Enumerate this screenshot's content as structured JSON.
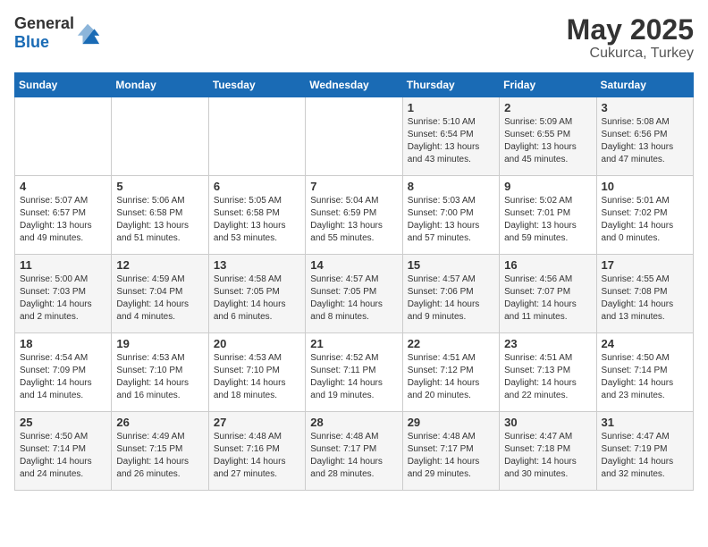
{
  "header": {
    "logo_general": "General",
    "logo_blue": "Blue",
    "month_year": "May 2025",
    "location": "Cukurca, Turkey"
  },
  "calendar": {
    "weekdays": [
      "Sunday",
      "Monday",
      "Tuesday",
      "Wednesday",
      "Thursday",
      "Friday",
      "Saturday"
    ],
    "weeks": [
      [
        {
          "day": "",
          "info": ""
        },
        {
          "day": "",
          "info": ""
        },
        {
          "day": "",
          "info": ""
        },
        {
          "day": "",
          "info": ""
        },
        {
          "day": "1",
          "info": "Sunrise: 5:10 AM\nSunset: 6:54 PM\nDaylight: 13 hours\nand 43 minutes."
        },
        {
          "day": "2",
          "info": "Sunrise: 5:09 AM\nSunset: 6:55 PM\nDaylight: 13 hours\nand 45 minutes."
        },
        {
          "day": "3",
          "info": "Sunrise: 5:08 AM\nSunset: 6:56 PM\nDaylight: 13 hours\nand 47 minutes."
        }
      ],
      [
        {
          "day": "4",
          "info": "Sunrise: 5:07 AM\nSunset: 6:57 PM\nDaylight: 13 hours\nand 49 minutes."
        },
        {
          "day": "5",
          "info": "Sunrise: 5:06 AM\nSunset: 6:58 PM\nDaylight: 13 hours\nand 51 minutes."
        },
        {
          "day": "6",
          "info": "Sunrise: 5:05 AM\nSunset: 6:58 PM\nDaylight: 13 hours\nand 53 minutes."
        },
        {
          "day": "7",
          "info": "Sunrise: 5:04 AM\nSunset: 6:59 PM\nDaylight: 13 hours\nand 55 minutes."
        },
        {
          "day": "8",
          "info": "Sunrise: 5:03 AM\nSunset: 7:00 PM\nDaylight: 13 hours\nand 57 minutes."
        },
        {
          "day": "9",
          "info": "Sunrise: 5:02 AM\nSunset: 7:01 PM\nDaylight: 13 hours\nand 59 minutes."
        },
        {
          "day": "10",
          "info": "Sunrise: 5:01 AM\nSunset: 7:02 PM\nDaylight: 14 hours\nand 0 minutes."
        }
      ],
      [
        {
          "day": "11",
          "info": "Sunrise: 5:00 AM\nSunset: 7:03 PM\nDaylight: 14 hours\nand 2 minutes."
        },
        {
          "day": "12",
          "info": "Sunrise: 4:59 AM\nSunset: 7:04 PM\nDaylight: 14 hours\nand 4 minutes."
        },
        {
          "day": "13",
          "info": "Sunrise: 4:58 AM\nSunset: 7:05 PM\nDaylight: 14 hours\nand 6 minutes."
        },
        {
          "day": "14",
          "info": "Sunrise: 4:57 AM\nSunset: 7:05 PM\nDaylight: 14 hours\nand 8 minutes."
        },
        {
          "day": "15",
          "info": "Sunrise: 4:57 AM\nSunset: 7:06 PM\nDaylight: 14 hours\nand 9 minutes."
        },
        {
          "day": "16",
          "info": "Sunrise: 4:56 AM\nSunset: 7:07 PM\nDaylight: 14 hours\nand 11 minutes."
        },
        {
          "day": "17",
          "info": "Sunrise: 4:55 AM\nSunset: 7:08 PM\nDaylight: 14 hours\nand 13 minutes."
        }
      ],
      [
        {
          "day": "18",
          "info": "Sunrise: 4:54 AM\nSunset: 7:09 PM\nDaylight: 14 hours\nand 14 minutes."
        },
        {
          "day": "19",
          "info": "Sunrise: 4:53 AM\nSunset: 7:10 PM\nDaylight: 14 hours\nand 16 minutes."
        },
        {
          "day": "20",
          "info": "Sunrise: 4:53 AM\nSunset: 7:10 PM\nDaylight: 14 hours\nand 18 minutes."
        },
        {
          "day": "21",
          "info": "Sunrise: 4:52 AM\nSunset: 7:11 PM\nDaylight: 14 hours\nand 19 minutes."
        },
        {
          "day": "22",
          "info": "Sunrise: 4:51 AM\nSunset: 7:12 PM\nDaylight: 14 hours\nand 20 minutes."
        },
        {
          "day": "23",
          "info": "Sunrise: 4:51 AM\nSunset: 7:13 PM\nDaylight: 14 hours\nand 22 minutes."
        },
        {
          "day": "24",
          "info": "Sunrise: 4:50 AM\nSunset: 7:14 PM\nDaylight: 14 hours\nand 23 minutes."
        }
      ],
      [
        {
          "day": "25",
          "info": "Sunrise: 4:50 AM\nSunset: 7:14 PM\nDaylight: 14 hours\nand 24 minutes."
        },
        {
          "day": "26",
          "info": "Sunrise: 4:49 AM\nSunset: 7:15 PM\nDaylight: 14 hours\nand 26 minutes."
        },
        {
          "day": "27",
          "info": "Sunrise: 4:48 AM\nSunset: 7:16 PM\nDaylight: 14 hours\nand 27 minutes."
        },
        {
          "day": "28",
          "info": "Sunrise: 4:48 AM\nSunset: 7:17 PM\nDaylight: 14 hours\nand 28 minutes."
        },
        {
          "day": "29",
          "info": "Sunrise: 4:48 AM\nSunset: 7:17 PM\nDaylight: 14 hours\nand 29 minutes."
        },
        {
          "day": "30",
          "info": "Sunrise: 4:47 AM\nSunset: 7:18 PM\nDaylight: 14 hours\nand 30 minutes."
        },
        {
          "day": "31",
          "info": "Sunrise: 4:47 AM\nSunset: 7:19 PM\nDaylight: 14 hours\nand 32 minutes."
        }
      ]
    ]
  }
}
